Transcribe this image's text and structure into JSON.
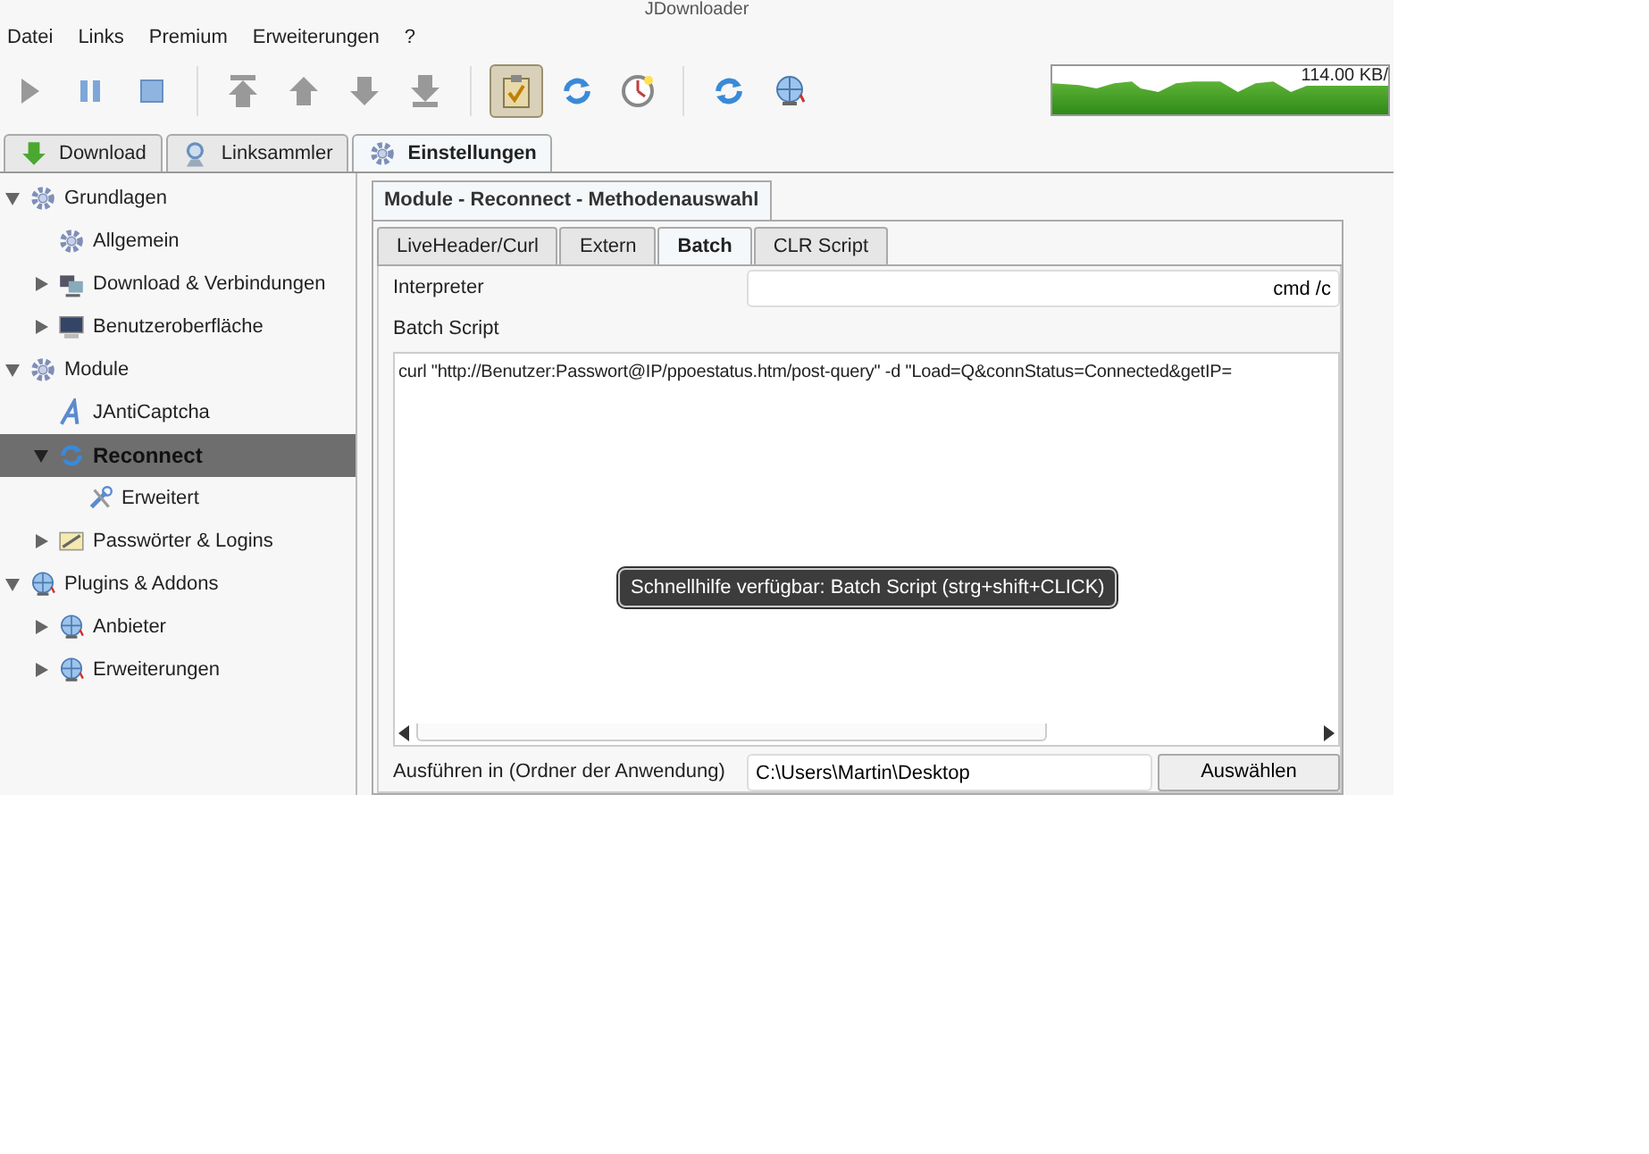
{
  "window": {
    "title": "JDownloader"
  },
  "menu": [
    "Datei",
    "Links",
    "Premium",
    "Erweiterungen",
    "?"
  ],
  "toolbar": [
    {
      "kind": "play",
      "pressed": false
    },
    {
      "kind": "pause",
      "pressed": false
    },
    {
      "kind": "stop",
      "pressed": false
    },
    {
      "kind": "sep"
    },
    {
      "kind": "top",
      "pressed": false
    },
    {
      "kind": "up",
      "pressed": false
    },
    {
      "kind": "down",
      "pressed": false
    },
    {
      "kind": "bottom",
      "pressed": false
    },
    {
      "kind": "sep"
    },
    {
      "kind": "clipboard",
      "pressed": true
    },
    {
      "kind": "reconnect",
      "pressed": false
    },
    {
      "kind": "clock",
      "pressed": false
    },
    {
      "kind": "sep"
    },
    {
      "kind": "refresh",
      "pressed": false
    },
    {
      "kind": "globe",
      "pressed": false
    }
  ],
  "speed": {
    "reading": "114.00 KB/"
  },
  "main_tabs": [
    {
      "label": "Download",
      "kind": "download",
      "selected": false
    },
    {
      "label": "Linksammler",
      "kind": "collector",
      "selected": false
    },
    {
      "label": "Einstellungen",
      "kind": "settings",
      "selected": true
    }
  ],
  "sidebar": {
    "items": [
      {
        "label": "Grundlagen",
        "kind": "gear",
        "expanded": true,
        "selected": false,
        "children": [
          {
            "label": "Allgemein",
            "kind": "gear",
            "selected": false
          },
          {
            "label": "Download & Verbindungen",
            "kind": "network",
            "expanded": false,
            "selected": false
          },
          {
            "label": "Benutzeroberfläche",
            "kind": "monitor",
            "expanded": false,
            "selected": false
          }
        ]
      },
      {
        "label": "Module",
        "kind": "gear",
        "expanded": true,
        "selected": false,
        "children": [
          {
            "label": "JAntiCaptcha",
            "kind": "letter",
            "selected": false
          },
          {
            "label": "Reconnect",
            "kind": "reconnect",
            "expanded": true,
            "selected": true,
            "children": [
              {
                "label": "Erweitert",
                "kind": "tools",
                "selected": false
              }
            ]
          },
          {
            "label": "Passwörter & Logins",
            "kind": "note",
            "expanded": false,
            "selected": false
          }
        ]
      },
      {
        "label": "Plugins & Addons",
        "kind": "globe",
        "expanded": true,
        "selected": false,
        "children": [
          {
            "label": "Anbieter",
            "kind": "globe",
            "expanded": false,
            "selected": false
          },
          {
            "label": "Erweiterungen",
            "kind": "globe",
            "expanded": false,
            "selected": false
          }
        ]
      }
    ]
  },
  "panel": {
    "title": "Module - Reconnect - Methodenauswahl",
    "tabs": [
      {
        "label": "LiveHeader/Curl",
        "selected": false
      },
      {
        "label": "Extern",
        "selected": false
      },
      {
        "label": "Batch",
        "selected": true
      },
      {
        "label": "CLR Script",
        "selected": false
      }
    ],
    "interpreter_label": "Interpreter",
    "interpreter_value": "cmd /c",
    "script_label": "Batch Script",
    "script_value": "curl \"http://Benutzer:Passwort@IP/ppoestatus.htm/post-query\" -d \"Load=Q&connStatus=Connected&getIP=",
    "tooltip": "Schnellhilfe verfügbar: Batch Script (strg+shift+CLICK)",
    "folder_label": "Ausführen in (Ordner der Anwendung)",
    "folder_value": "C:\\Users\\Martin\\Desktop",
    "browse_button": "Auswählen"
  }
}
